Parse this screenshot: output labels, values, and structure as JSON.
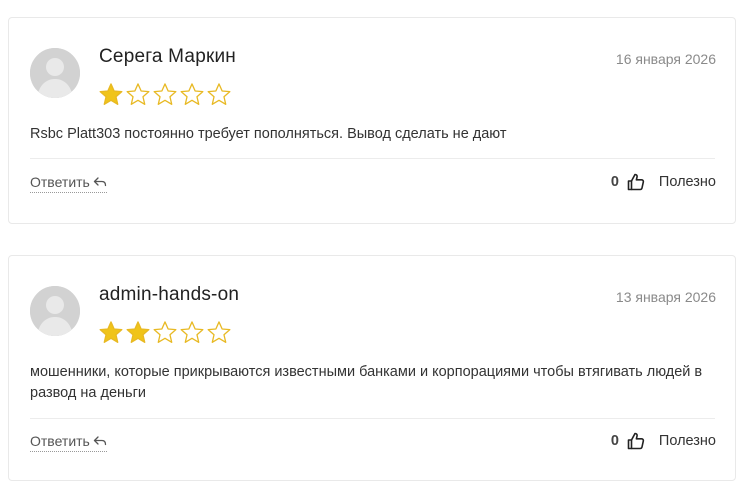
{
  "reviews": [
    {
      "author": "Серега Маркин",
      "date": "16 января 2026",
      "rating": 1,
      "max_rating": 5,
      "text": "Rsbc Platt303 постоянно требует пополняться. Вывод сделать не дают",
      "reply_label": "Ответить",
      "useful_count": "0",
      "useful_label": "Полезно"
    },
    {
      "author": "admin-hands-on",
      "date": "13 января 2026",
      "rating": 2,
      "max_rating": 5,
      "text": "мошенники, которые прикрываются известными банками и корпорациями чтобы втягивать людей в развод на деньги",
      "reply_label": "Ответить",
      "useful_count": "0",
      "useful_label": "Полезно"
    }
  ],
  "colors": {
    "star_filled": "#f0c419",
    "star_outline": "#e8b923",
    "avatar_bg": "#d2d2d2",
    "border": "#e9e9e9"
  },
  "icons": {
    "avatar": "user-avatar-icon",
    "star": "star-icon",
    "reply": "reply-arrow-icon",
    "like": "thumbs-up-icon"
  }
}
